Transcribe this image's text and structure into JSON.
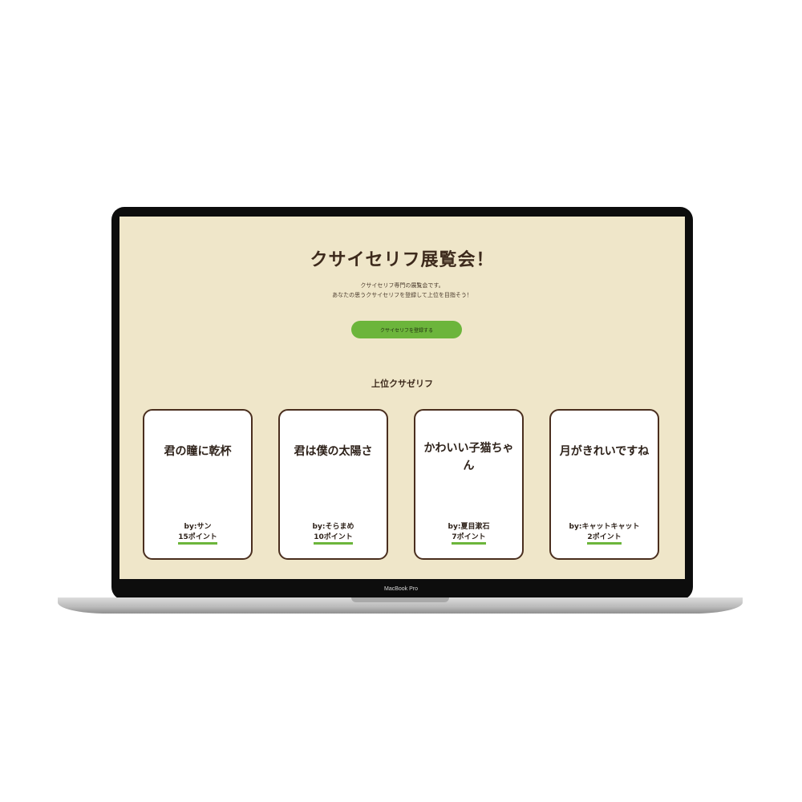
{
  "hero": {
    "title": "クサイセリフ展覧会！",
    "description_line1": "クサイセリフ専門の展覧会です。",
    "description_line2": "あなたの思うクサイセリフを登録して上位を目指そう！",
    "register_button": "クサイセリフを登録する"
  },
  "ranking": {
    "title": "上位クサゼリフ",
    "cards": [
      {
        "text": "君の瞳に乾杯",
        "author": "by:サン",
        "points": "15ポイント"
      },
      {
        "text": "君は僕の太陽さ",
        "author": "by:そらまめ",
        "points": "10ポイント"
      },
      {
        "text": "かわいい子猫ちゃん",
        "author": "by:夏目漱石",
        "points": "7ポイント"
      },
      {
        "text": "月がきれいですね",
        "author": "by:キャットキャット",
        "points": "2ポイント"
      }
    ]
  },
  "device": {
    "model": "MacBook Pro"
  },
  "colors": {
    "background": "#efe6c9",
    "accent": "#6cb53b",
    "card_border": "#4a2e1e",
    "text": "#3d2a1c"
  }
}
